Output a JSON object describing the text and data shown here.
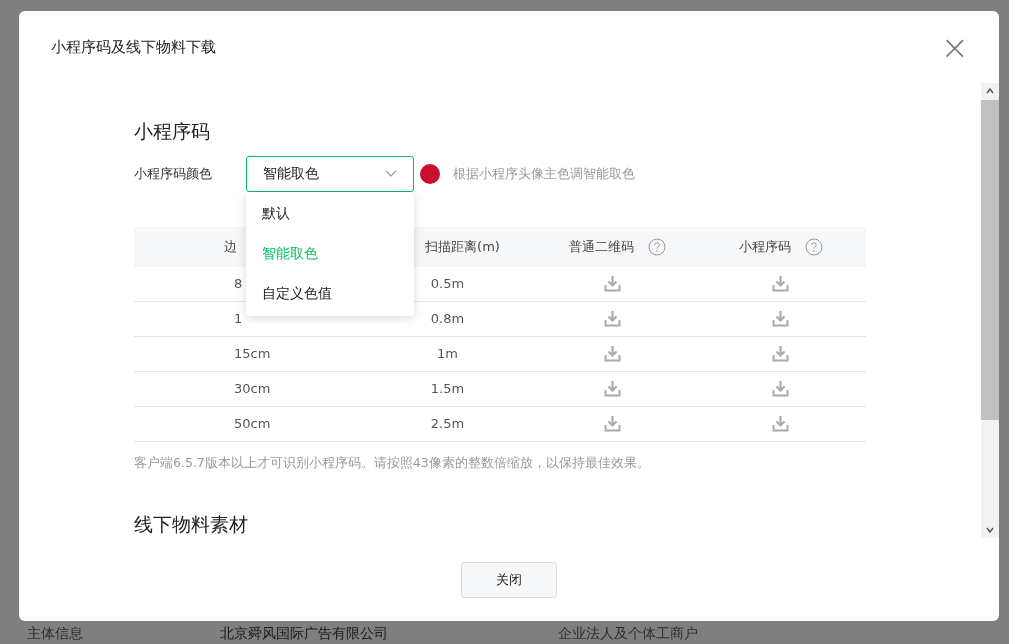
{
  "dialog": {
    "title": "小程序码及线下物料下载",
    "close": "×"
  },
  "section_1": {
    "heading": "小程序码",
    "color_label": "小程序码颜色",
    "select": {
      "value": "智能取色",
      "expanded": true,
      "options": [
        {
          "label": "默认",
          "selected": false
        },
        {
          "label": "智能取色",
          "selected": true
        },
        {
          "label": "自定义色值",
          "selected": false
        }
      ]
    },
    "swatch": {
      "color": "#c8102e"
    },
    "hint": "根据小程序头像主色调智能取色"
  },
  "table": {
    "columns": [
      {
        "label": "边",
        "help": false
      },
      {
        "label": "扫描距离(m)",
        "help": false
      },
      {
        "label": "普通二维码",
        "help": true
      },
      {
        "label": "小程序码",
        "help": true
      }
    ],
    "rows": [
      {
        "size": "8",
        "distance": "0.5m"
      },
      {
        "size": "1",
        "distance": "0.8m"
      },
      {
        "size": "15cm",
        "distance": "1m"
      },
      {
        "size": "30cm",
        "distance": "1.5m"
      },
      {
        "size": "50cm",
        "distance": "2.5m"
      }
    ]
  },
  "note": "客户端6.5.7版本以上才可识别小程序码。请按照43像素的整数倍缩放，以保持最佳效果。",
  "section_2": {
    "heading": "线下物料素材"
  },
  "footer": {
    "button": "关闭"
  },
  "background_row": [
    "主体信息",
    "北京舜风国际广告有限公司",
    "企业法人及个体工商户"
  ]
}
